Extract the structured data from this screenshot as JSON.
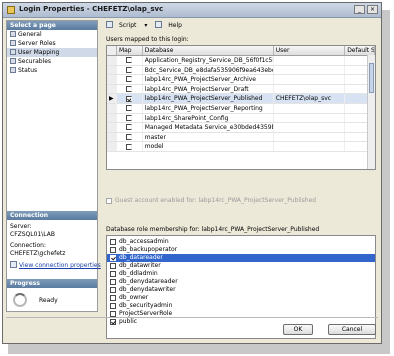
{
  "window": {
    "title": "Login Properties - CHEFETZ\\olap_svc"
  },
  "left_panel": {
    "select_page_header": "Select a page",
    "pages": [
      {
        "label": "General",
        "selected": false
      },
      {
        "label": "Server Roles",
        "selected": false
      },
      {
        "label": "User Mapping",
        "selected": true
      },
      {
        "label": "Securables",
        "selected": false
      },
      {
        "label": "Status",
        "selected": false
      }
    ],
    "connection_header": "Connection",
    "server_label": "Server:",
    "server_value": "CFZSQL01\\LAB",
    "connection_label": "Connection:",
    "connection_value": "CHEFETZ\\gchefetz",
    "view_connection_link": "View connection properties",
    "progress_header": "Progress",
    "progress_status": "Ready"
  },
  "toolbar": {
    "script_label": "Script",
    "help_label": "Help"
  },
  "users_mapped": {
    "label": "Users mapped to this login:",
    "columns": [
      "Map",
      "Database",
      "User",
      "Default Schema"
    ],
    "rows": [
      {
        "map": false,
        "database": "Application_Registry_Service_DB_56f0f1c5b038...",
        "user": "",
        "schema": ""
      },
      {
        "map": false,
        "database": "Bdc_Service_DB_e8dafa535906f9ea643ebd8...",
        "user": "",
        "schema": ""
      },
      {
        "map": false,
        "database": "labp14rc_PWA_ProjectServer_Archive",
        "user": "",
        "schema": ""
      },
      {
        "map": false,
        "database": "labp14rc_PWA_ProjectServer_Draft",
        "user": "",
        "schema": ""
      },
      {
        "map": true,
        "database": "labp14rc_PWA_ProjectServer_Published",
        "user": "CHEFETZ\\olap_svc",
        "schema": "",
        "highlighted": true
      },
      {
        "map": false,
        "database": "labp14rc_PWA_ProjectServer_Reporting",
        "user": "",
        "schema": ""
      },
      {
        "map": false,
        "database": "labp14rc_SharePoint_Config",
        "user": "",
        "schema": ""
      },
      {
        "map": false,
        "database": "Managed Metadata Service_e30bded4359b402...",
        "user": "",
        "schema": ""
      },
      {
        "map": false,
        "database": "master",
        "user": "",
        "schema": ""
      },
      {
        "map": false,
        "database": "model",
        "user": "",
        "schema": ""
      }
    ]
  },
  "guest_account": {
    "label": "Guest account enabled for: labp14rc_PWA_ProjectServer_Published",
    "checked": false
  },
  "role_membership": {
    "label": "Database role membership for: labp14rc_PWA_ProjectServer_Published",
    "roles": [
      {
        "name": "db_accessadmin",
        "checked": false,
        "selected": false
      },
      {
        "name": "db_backupoperator",
        "checked": false,
        "selected": false
      },
      {
        "name": "db_datareader",
        "checked": true,
        "selected": true
      },
      {
        "name": "db_datawriter",
        "checked": false,
        "selected": false
      },
      {
        "name": "db_ddladmin",
        "checked": false,
        "selected": false
      },
      {
        "name": "db_denydatareader",
        "checked": false,
        "selected": false
      },
      {
        "name": "db_denydatawriter",
        "checked": false,
        "selected": false
      },
      {
        "name": "db_owner",
        "checked": false,
        "selected": false
      },
      {
        "name": "db_securityadmin",
        "checked": false,
        "selected": false
      },
      {
        "name": "ProjectServerRole",
        "checked": false,
        "selected": false
      },
      {
        "name": "public",
        "checked": true,
        "selected": false
      }
    ]
  },
  "buttons": {
    "ok": "OK",
    "cancel": "Cancel"
  }
}
